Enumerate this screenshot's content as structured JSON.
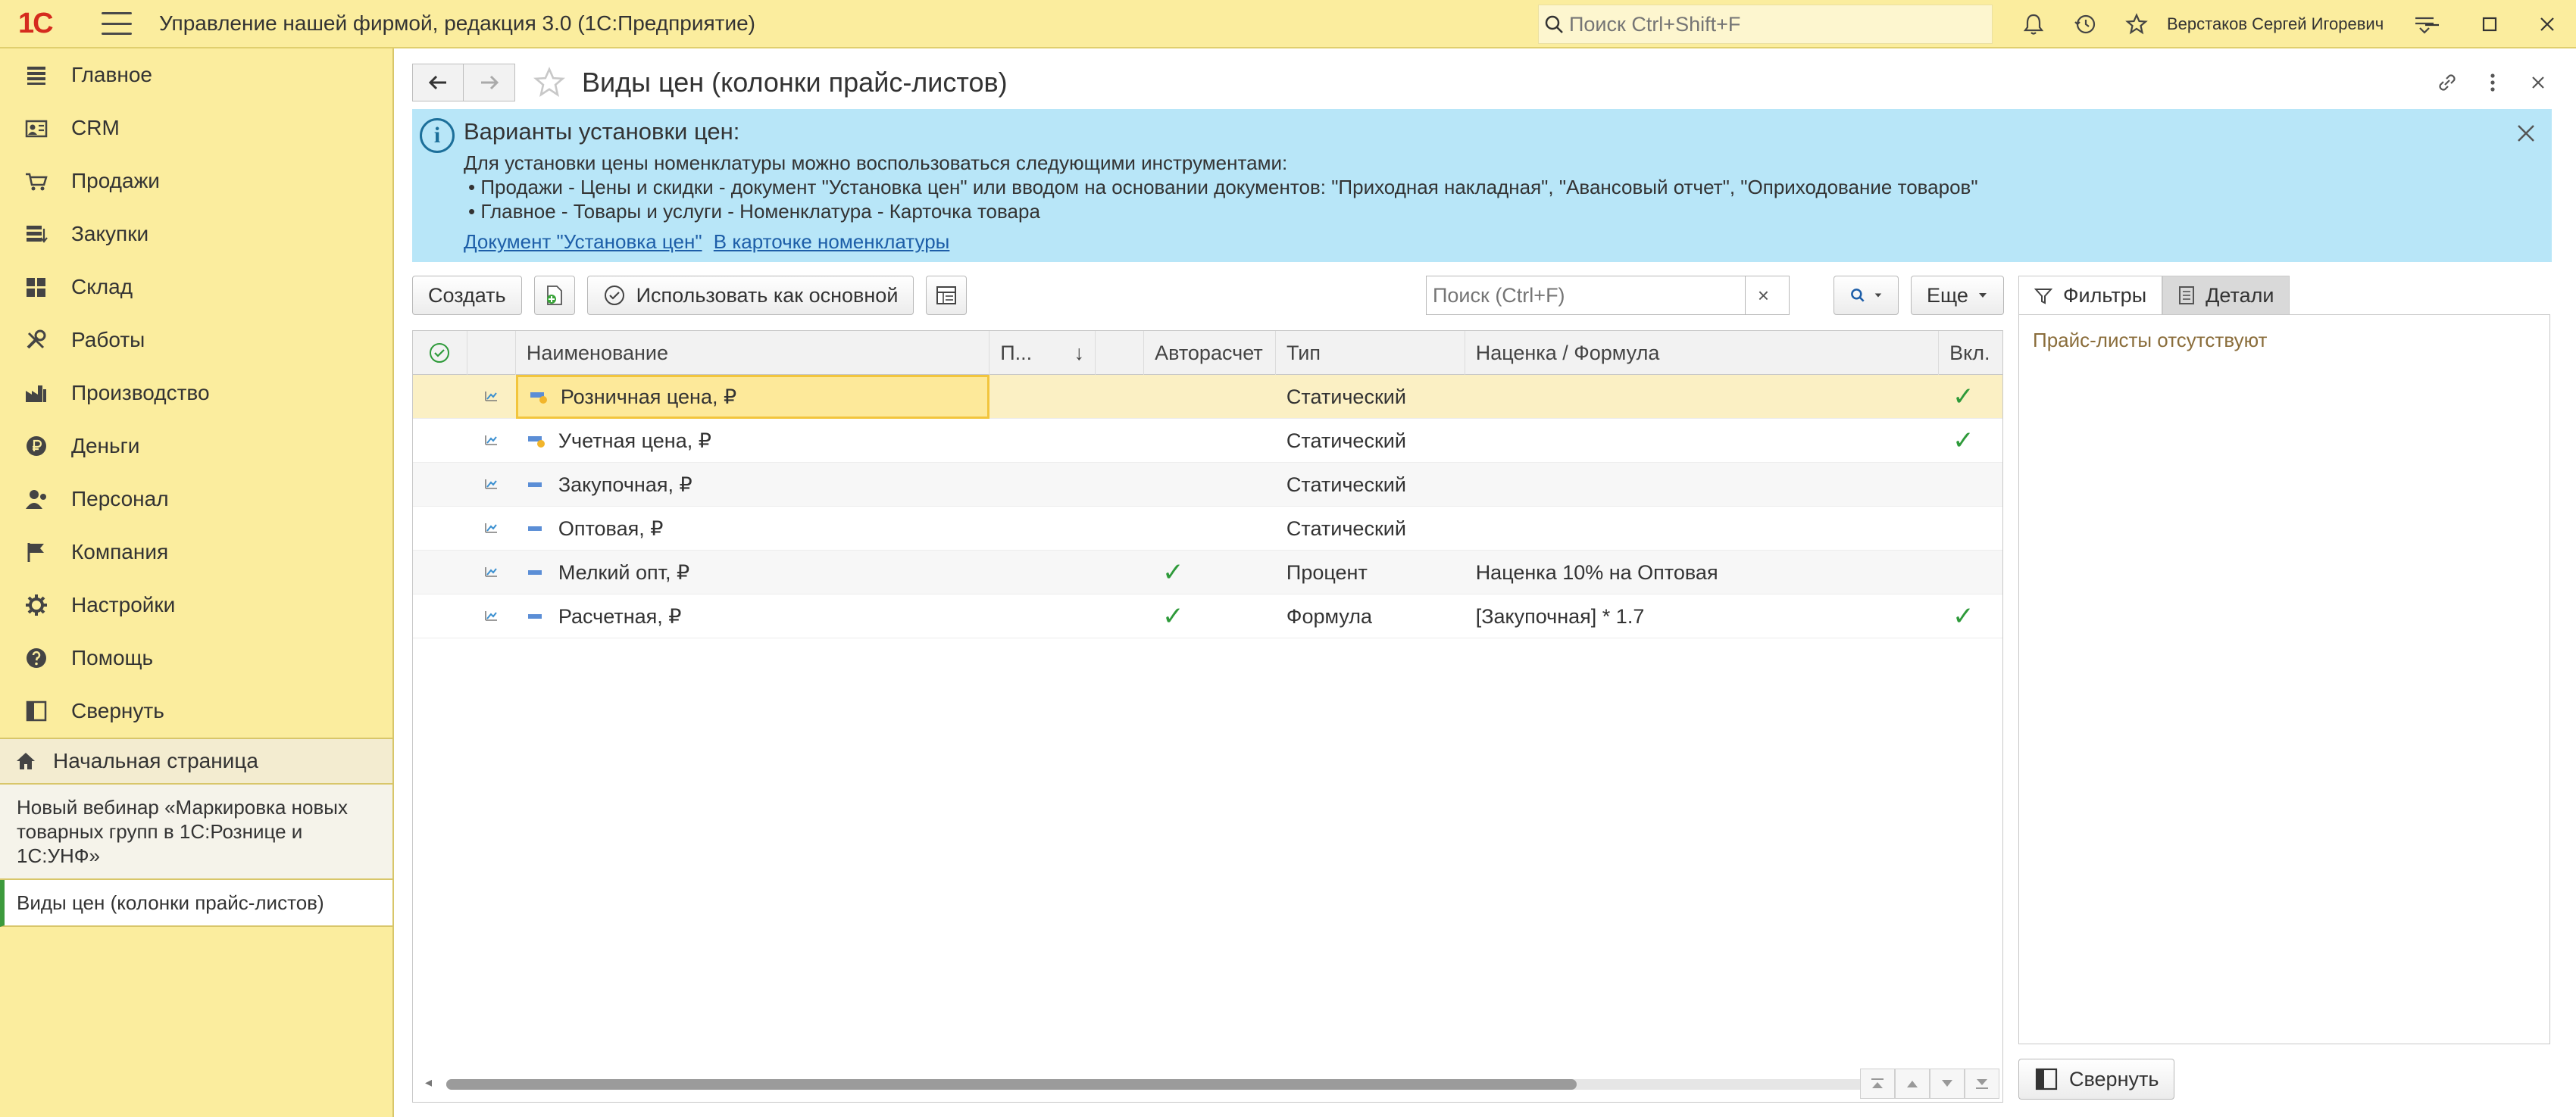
{
  "app": {
    "logo": "1С",
    "title": "Управление нашей фирмой, редакция 3.0  (1С:Предприятие)",
    "search_placeholder": "Поиск Ctrl+Shift+F",
    "user": "Верстаков Сергей Игоревич"
  },
  "sidebar": {
    "items": [
      {
        "label": "Главное",
        "icon": "list-icon"
      },
      {
        "label": "CRM",
        "icon": "crm-icon"
      },
      {
        "label": "Продажи",
        "icon": "cart-icon"
      },
      {
        "label": "Закупки",
        "icon": "purchases-icon"
      },
      {
        "label": "Склад",
        "icon": "warehouse-icon"
      },
      {
        "label": "Работы",
        "icon": "tools-icon"
      },
      {
        "label": "Производство",
        "icon": "factory-icon"
      },
      {
        "label": "Деньги",
        "icon": "ruble-icon"
      },
      {
        "label": "Персонал",
        "icon": "person-icon"
      },
      {
        "label": "Компания",
        "icon": "flag-icon"
      },
      {
        "label": "Настройки",
        "icon": "gear-icon"
      },
      {
        "label": "Помощь",
        "icon": "help-icon"
      },
      {
        "label": "Свернуть",
        "icon": "collapse-icon"
      }
    ],
    "home": "Начальная страница",
    "open_items": [
      "Новый вебинар «Маркировка новых товарных групп в 1С:Рознице и 1С:УНФ»",
      "Виды цен (колонки прайс-листов)"
    ]
  },
  "page": {
    "title": "Виды цен (колонки прайс-листов)"
  },
  "info": {
    "icon": "i",
    "title": "Варианты установки цен:",
    "lines": [
      "Для установки цены номенклатуры можно воспользоваться следующими инструментами:",
      "• Продажи - Цены и скидки - документ \"Установка цен\" или вводом на основании документов: \"Приходная накладная\", \"Авансовый отчет\", \"Оприходование товаров\"",
      "• Главное - Товары и услуги - Номенклатура - Карточка товара"
    ],
    "links": [
      "Документ \"Установка цен\"",
      "В карточке номенклатуры"
    ]
  },
  "toolbar": {
    "create": "Создать",
    "use_as_main": "Использовать как основной",
    "search_placeholder": "Поиск (Ctrl+F)",
    "clear": "×",
    "more": "Еще"
  },
  "table": {
    "columns": [
      "",
      "",
      "Наименование",
      "П...",
      "",
      "Авторасчет",
      "Тип",
      "Наценка / Формула",
      "Вкл."
    ],
    "sort_indicator": "↓",
    "rows": [
      {
        "name": "Розничная цена, ₽",
        "auto": false,
        "type": "Статический",
        "formula": "",
        "enabled": true,
        "icon": "base-price-icon"
      },
      {
        "name": "Учетная цена, ₽",
        "auto": false,
        "type": "Статический",
        "formula": "",
        "enabled": true,
        "icon": "base-price-icon"
      },
      {
        "name": "Закупочная, ₽",
        "auto": false,
        "type": "Статический",
        "formula": "",
        "enabled": false,
        "icon": "price-type-icon"
      },
      {
        "name": "Оптовая, ₽",
        "auto": false,
        "type": "Статический",
        "formula": "",
        "enabled": false,
        "icon": "price-type-icon"
      },
      {
        "name": "Мелкий опт, ₽",
        "auto": true,
        "type": "Процент",
        "formula": "Наценка 10% на Оптовая",
        "enabled": false,
        "icon": "price-type-icon"
      },
      {
        "name": "Расчетная, ₽",
        "auto": true,
        "type": "Формула",
        "formula": "[Закупочная] * 1.7",
        "enabled": true,
        "icon": "price-type-icon"
      }
    ],
    "check_mark": "✓"
  },
  "right_panel": {
    "tabs": [
      "Фильтры",
      "Детали"
    ],
    "empty_text": "Прайс-листы отсутствуют",
    "collapse": "Свернуть"
  },
  "colors": {
    "accent_yellow": "#fbed9e",
    "banner_blue": "#b8e6f8",
    "check_green": "#2e9a3a",
    "selected_row": "#fbf0c4"
  }
}
